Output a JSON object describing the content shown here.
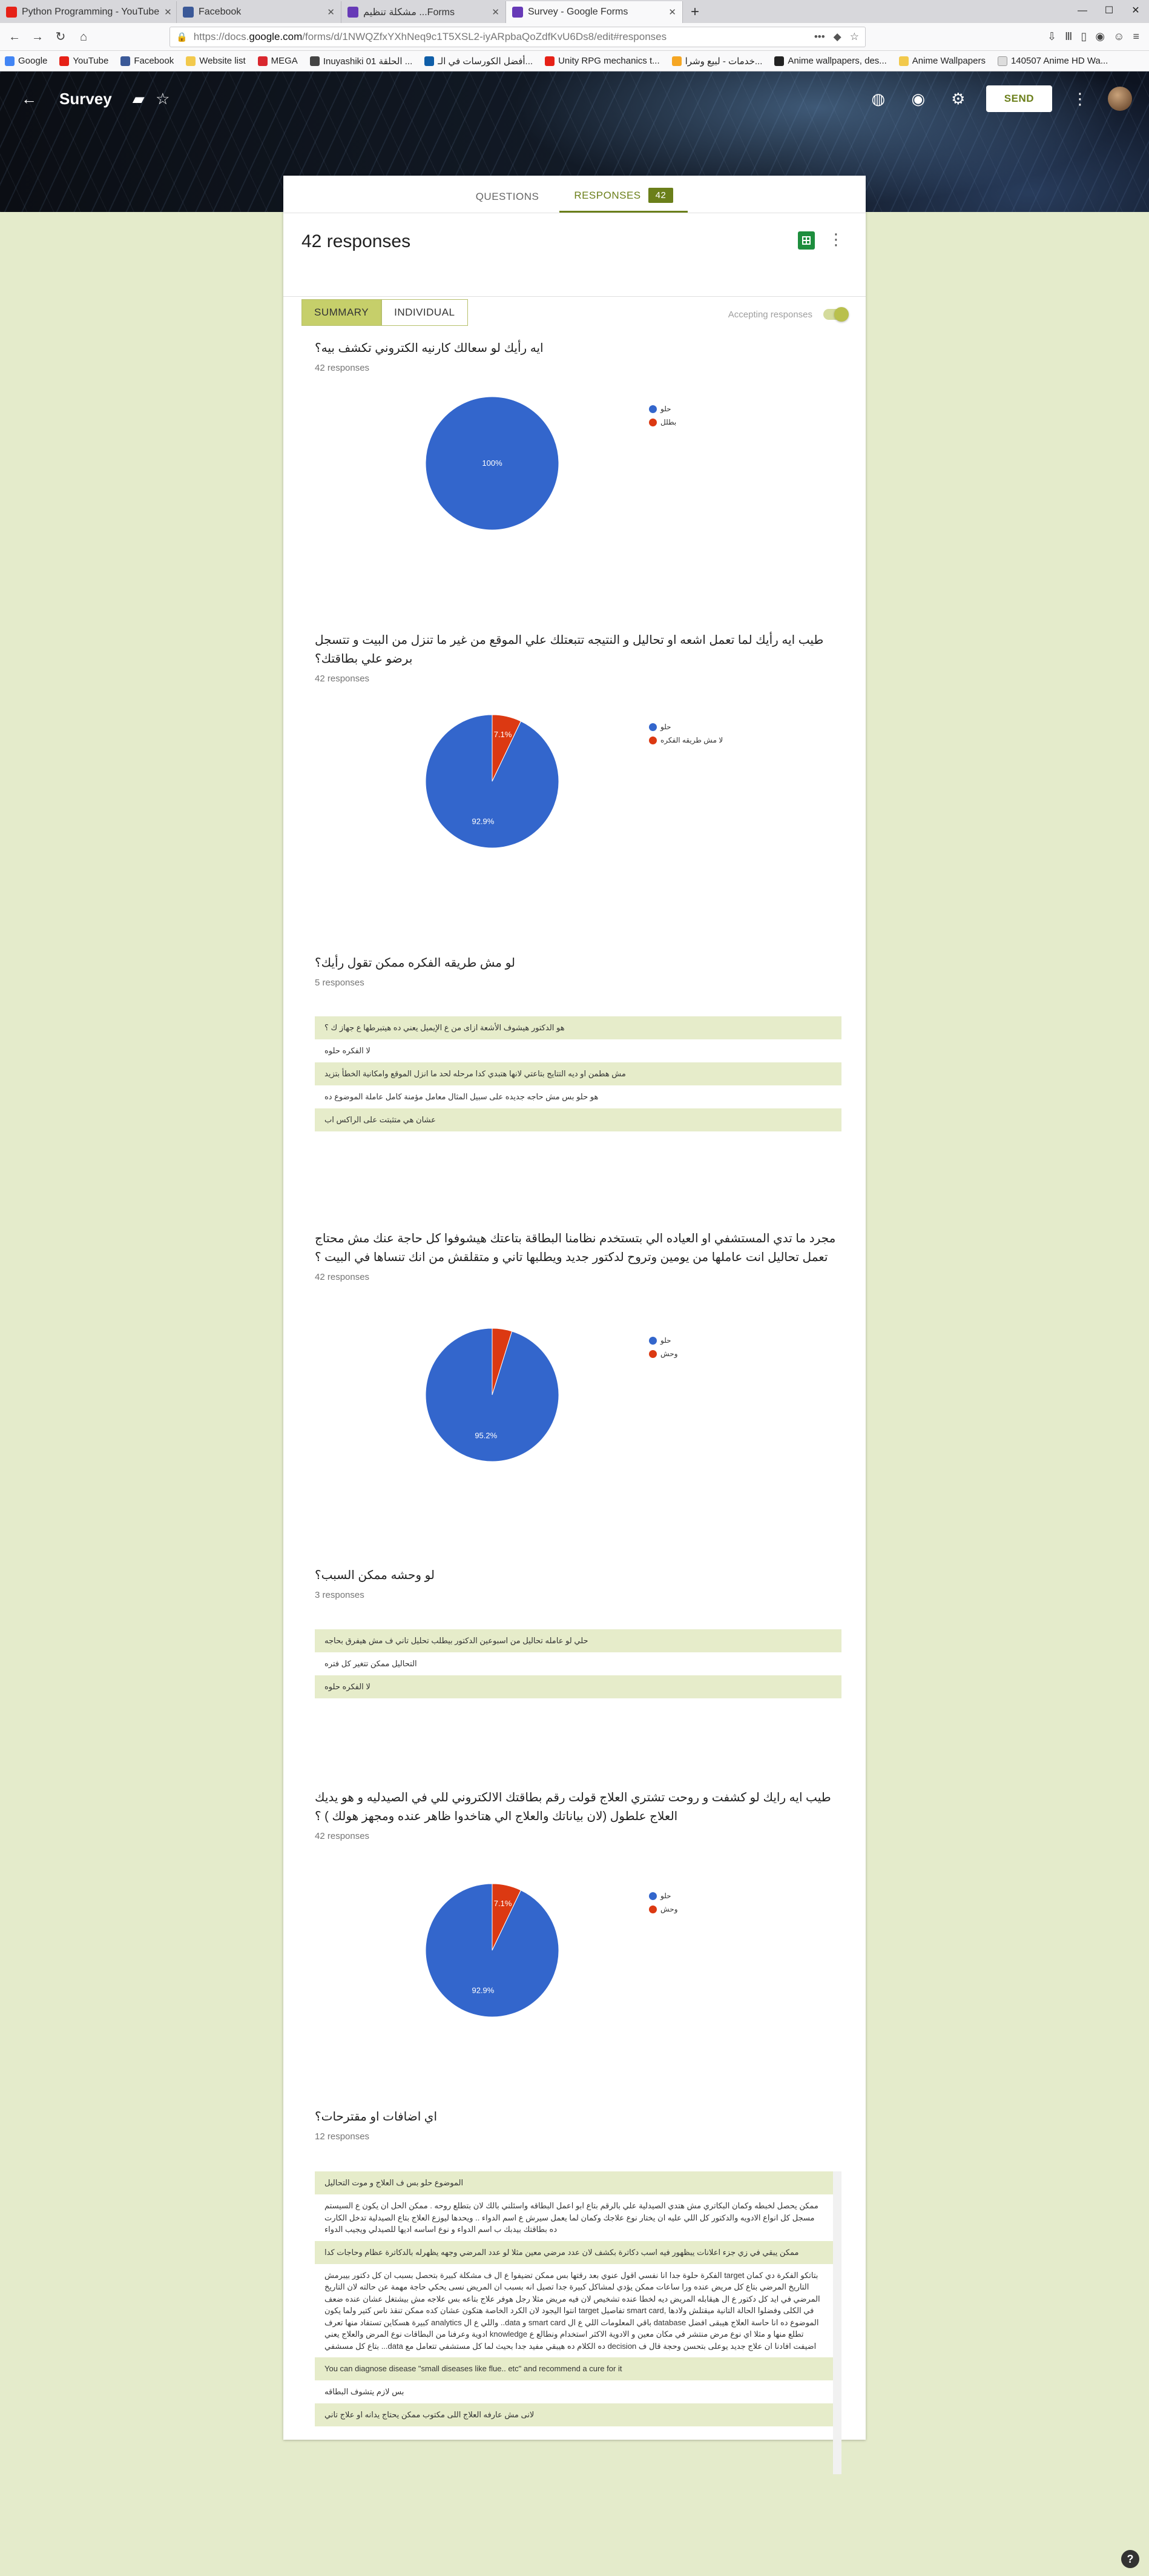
{
  "browser": {
    "tabs": [
      {
        "label": "Python Programming - YouTube",
        "color": "#e62117"
      },
      {
        "label": "Facebook",
        "color": "#3b5998"
      },
      {
        "label": "مشكلة تنظيم ...Forms",
        "color": "#673ab7"
      },
      {
        "label": "Survey - Google Forms",
        "color": "#673ab7",
        "active": true
      }
    ],
    "url": {
      "prefix": "https://docs.",
      "domain": "google.com",
      "path": "/forms/d/1NWQZfxYXhNeq9c1T5XSL2-iyARpbaQoZdfKvU6Ds8/edit#responses"
    },
    "bookmarks": [
      "Google",
      "YouTube",
      "Facebook",
      "Website list",
      "MEGA",
      "Inuyashiki 01 الحلقة ...",
      "أفضل الكورسات في الـ...",
      "Unity RPG mechanics t...",
      "خدمات - لبيع وشرا...",
      "Anime wallpapers, des...",
      "Anime Wallpapers",
      "140507 Anime HD Wa..."
    ]
  },
  "forms_header": {
    "title": "Survey",
    "send_label": "SEND"
  },
  "tabs": {
    "questions": "QUESTIONS",
    "responses": "RESPONSES",
    "responses_count": "42"
  },
  "summary": {
    "title": "42 responses",
    "seg_summary": "SUMMARY",
    "seg_individual": "INDIVIDUAL",
    "accepting": "Accepting responses"
  },
  "questions": [
    {
      "title": "ايه رأيك لو سعالك كارنيه الكتروني تكشف بيه؟",
      "count": "42 responses",
      "type": "pie",
      "legend": [
        "حلو",
        "بطلل"
      ],
      "slices": [
        {
          "value": 100,
          "label": "100%",
          "color": "#3366cc"
        }
      ]
    },
    {
      "title": "طيب ايه رأيك لما تعمل اشعه او تحاليل و النتيجه تتبعتلك علي الموقع من غير ما تنزل من البيت و تتسجل برضو علي بطاقتك؟",
      "count": "42 responses",
      "type": "pie",
      "legend": [
        "حلو",
        "لا مش طريقه الفكره"
      ],
      "slices": [
        {
          "value": 92.9,
          "label": "92.9%",
          "color": "#3366cc"
        },
        {
          "value": 7.1,
          "label": "7.1%",
          "color": "#dc3912"
        }
      ]
    },
    {
      "title": "لو مش طريقه الفكره ممكن تقول رأيك؟",
      "count": "5 responses",
      "type": "text",
      "answers": [
        "هو الدكتور هيشوف الأشعة ازاى من ع الإيميل يعني ده هيتبرطها ع جهاز ك ؟",
        "لا الفكره حلوه",
        "مش هطمن او ديه التتايج بتاعتي لانها هتبدي كدا مرحله لحد ما انزل الموقع وامكانية الخطأ بتزيد",
        "هو حلو بس مش حاجه جديده على سبيل المثال معامل مؤمنة كامل عاملة الموضوع ده",
        "عشان هي متثبتت على الراكس اب"
      ]
    },
    {
      "title": "مجرد ما تدي المستشفي او العياده الي بتستخدم نظامنا البطاقة بتاعتك هيشوفوا كل حاجة عنك مش محتاج تعمل تحاليل انت عاملها من يومين وتروح لدكتور جديد ويطلبها تاني و متقلقش من انك تنساها في البيت ؟",
      "count": "42 responses",
      "type": "pie",
      "legend": [
        "حلو",
        "وحش"
      ],
      "slices": [
        {
          "value": 95.2,
          "label": "95.2%",
          "color": "#3366cc"
        },
        {
          "value": 4.8,
          "label": "",
          "color": "#dc3912"
        }
      ]
    },
    {
      "title": "لو وحشه ممكن السبب؟",
      "count": "3 responses",
      "type": "text",
      "answers": [
        "حلي لو عامله تحاليل من اسبوعين الدكتور بيطلب تحليل تاني ف مش هيفرق بحاجه",
        "التحاليل ممكن تتغير كل فتره",
        "لا الفكره حلوه"
      ]
    },
    {
      "title": "طيب ايه رايك لو كشفت و روحت تشتري العلاج قولت رقم بطاقتك الالكتروني للي في الصيدليه و هو يديك العلاج علطول (لان بياناتك والعلاج الي هتاخدوا ظاهر عنده ومجهز هولك ) ؟",
      "count": "42 responses",
      "type": "pie",
      "legend": [
        "حلو",
        "وحش"
      ],
      "slices": [
        {
          "value": 92.9,
          "label": "92.9%",
          "color": "#3366cc"
        },
        {
          "value": 7.1,
          "label": "7.1%",
          "color": "#dc3912"
        }
      ]
    },
    {
      "title": "اي اضافات او مقترحات؟",
      "count": "12 responses",
      "type": "scroll",
      "answers": [
        "الموضوع حلو بس ف العلاج و موت التحاليل",
        "ممكن يحصل لخبطه وكمان البكاتري مش هتدي الصيدلية علي بالرقم بتاع ابو اعمل البطاقه واسئلني بالك لان بتطلع روحه . ممكن الحل ان يكون ع السيستم مسجل كل انواع الادويه والدكتور كل اللي عليه ان يختار نوع علاجك وكمان لما يعمل سيرش ع اسم الدواء .. ويحدها ليوزع العلاج بتاع الصيدلية تدخل الكارت ده بطاقتك بيدبك ب اسم الدواء و نوع اساسه اديها للصيدلي ويجيب الدواء",
        "ممكن يبقي في زي جزء اعلانات يبظهور فيه اسب دكاترة بكشف لان عدد مرضي معين مثلا لو عدد المرضي وجهه يظهرله بالدكاترة عظام وحاجات كدا",
        "بتاتكو الفكرة دي كمان target الفكرة حلوة جدا انا نفسي اقول عنوي بعد رقتها بس ممكن تضيفوا ع ال ف مشكلة كبيرة بتحصل بسبب ان كل دكتور بيبرمش التاريخ المرضي بتاع كل مريض عنده ورا ساعات ممكن يؤدي لمشاكل كبيرة جدا تصيل انه بسبب ان المريض نسى يحكي حاجة مهمة عن حالته لان التاريخ المرضي في ايد كل دكتور ع ال هيقابله المريض ديه لخطا عنده تشخيص لان فيه مريض مثلا رجل هوفر علاج بتاعه بس علاجه مش بيشتغل عشان عنده ضعف في الكلى وفضلوا الحالة التانية ميقتلش ولادها ,smart card تفاصيل target انتوا اليجود لان الكرد الخاصة هتكون عشان كده ممكن تنقذ ناس كتير ولما يكون الموضوع ده انا حاسة العلاج هيبقى افضل database باقي المعلومات اللي ع ال smart card و data.. واللي ع ال analytics كبيرة هسكاين تستفاد منها تعرف تطلع منها و مثلا اي نوع مرض منتشر في مكان معين و الادوية الاكثر استخدام ونطالع ع knowledge ادوية وعرفنا من البطاقات نوع المرض والعلاج يعني اضيفت افادنا ان علاج جديد يوعلى بتحسن وحجة قال ف decision ده الكلام ده هيبقي مفيد جدا بحيث لما كل مستشفي تتعامل مع data... بتاع كل مسشفي",
        "You can diagnose disease \"small diseases like flue.. etc\" and recommend a cure for it",
        "بس لازم يتشوف البطاقه",
        "لانى مش عارفه العلاج اللى مكتوب ممكن يحتاج يدانه او علاج تاني"
      ]
    }
  ]
}
